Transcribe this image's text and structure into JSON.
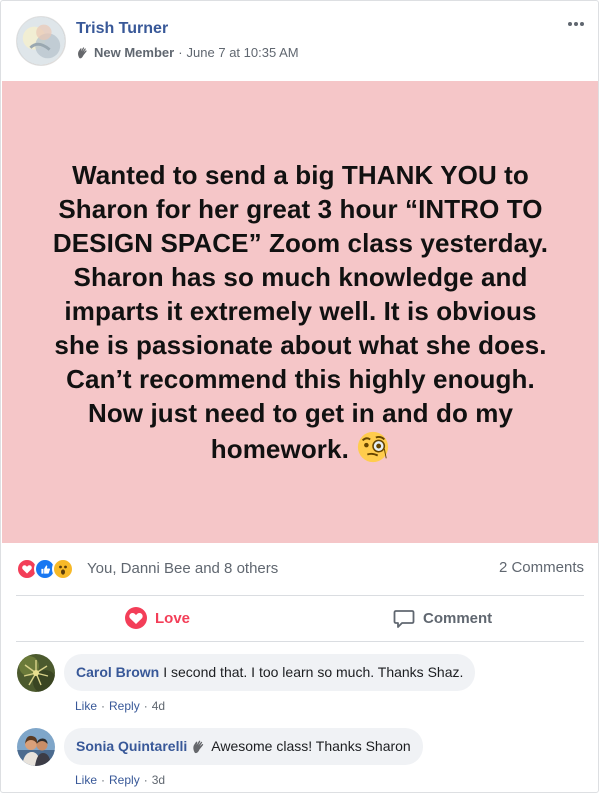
{
  "post": {
    "author": "Trish Turner",
    "badge": "New Member",
    "separator": "·",
    "timestamp": "June 7 at 10:35 AM",
    "text": "Wanted to send a big THANK YOU to Sharon for her great 3 hour “INTRO TO DESIGN SPACE” Zoom class yesterday. Sharon has so much knowledge and imparts it extremely well. It is obvious she is passionate about what she does. Can’t recommend this highly enough. Now just need to get in and do my homework.",
    "background_color": "#f5c6c8",
    "emoji": "monocle-face"
  },
  "reactions": {
    "icons": [
      "love",
      "like",
      "wow"
    ],
    "summary": "You, Danni Bee and 8 others",
    "comments_count": "2 Comments"
  },
  "actions": {
    "love_label": "Love",
    "comment_label": "Comment",
    "love_color": "#f33e58"
  },
  "comments": [
    {
      "author": "Carol Brown",
      "text": "I second that. I too learn so much. Thanks Shaz.",
      "like": "Like",
      "reply": "Reply",
      "age": "4d"
    },
    {
      "author": "Sonia Quintarelli",
      "text": "Awesome class! Thanks Sharon",
      "like": "Like",
      "reply": "Reply",
      "age": "3d"
    }
  ],
  "colors": {
    "link": "#385898",
    "muted": "#606770",
    "bubble": "#f0f2f5"
  }
}
